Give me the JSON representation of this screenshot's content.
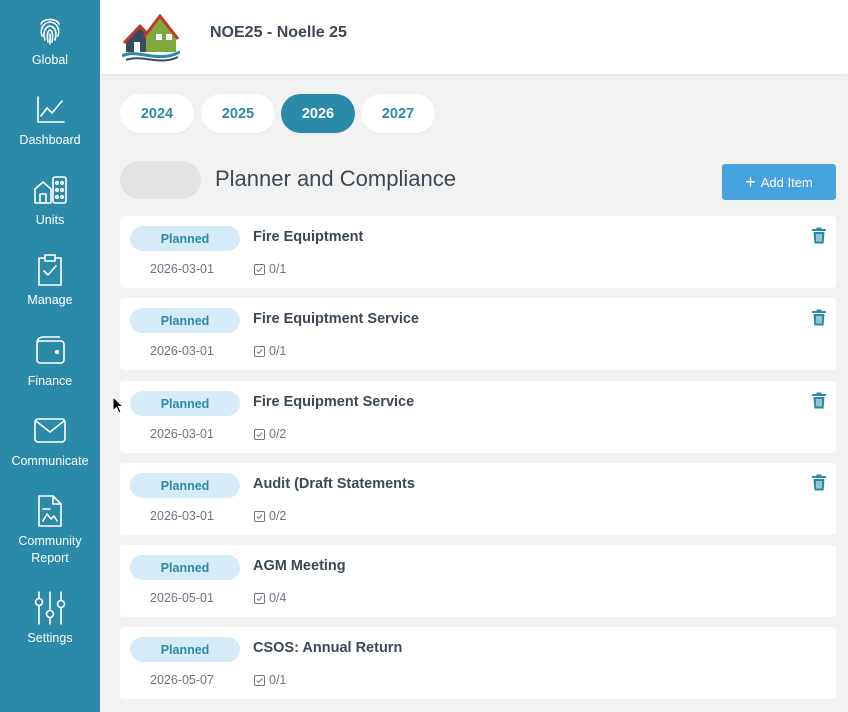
{
  "sidebar": {
    "items": [
      {
        "label": "Global",
        "icon": "fingerprint-icon"
      },
      {
        "label": "Dashboard",
        "icon": "chart-line-icon"
      },
      {
        "label": "Units",
        "icon": "buildings-icon"
      },
      {
        "label": "Manage",
        "icon": "clipboard-check-icon"
      },
      {
        "label": "Finance",
        "icon": "wallet-icon"
      },
      {
        "label": "Communicate",
        "icon": "envelope-icon"
      },
      {
        "label": "Community\nReport",
        "icon": "report-icon"
      },
      {
        "label": "Settings",
        "icon": "sliders-icon"
      }
    ]
  },
  "header": {
    "title": "NOE25 - Noelle 25"
  },
  "years": [
    "2024",
    "2025",
    "2026",
    "2027"
  ],
  "selected_year": "2026",
  "section": {
    "title": "Planner and Compliance",
    "add_label": "Add Item"
  },
  "items": [
    {
      "status": "Planned",
      "title": "Fire Equiptment",
      "date": "2026-03-01",
      "progress": "0/1",
      "deletable": true
    },
    {
      "status": "Planned",
      "title": "Fire Equiptment Service",
      "date": "2026-03-01",
      "progress": "0/1",
      "deletable": true
    },
    {
      "status": "Planned",
      "title": "Fire Equipment Service",
      "date": "2026-03-01",
      "progress": "0/2",
      "deletable": true
    },
    {
      "status": "Planned",
      "title": "Audit (Draft Statements",
      "date": "2026-03-01",
      "progress": "0/2",
      "deletable": true
    },
    {
      "status": "Planned",
      "title": "AGM Meeting",
      "date": "2026-05-01",
      "progress": "0/4",
      "deletable": false
    },
    {
      "status": "Planned",
      "title": "CSOS: Annual Return",
      "date": "2026-05-07",
      "progress": "0/1",
      "deletable": false
    }
  ],
  "colors": {
    "sidebar": "#2a8aa8",
    "accent": "#2a8aa8",
    "add_button": "#47a3de",
    "status_bg": "#d5ecf8"
  }
}
